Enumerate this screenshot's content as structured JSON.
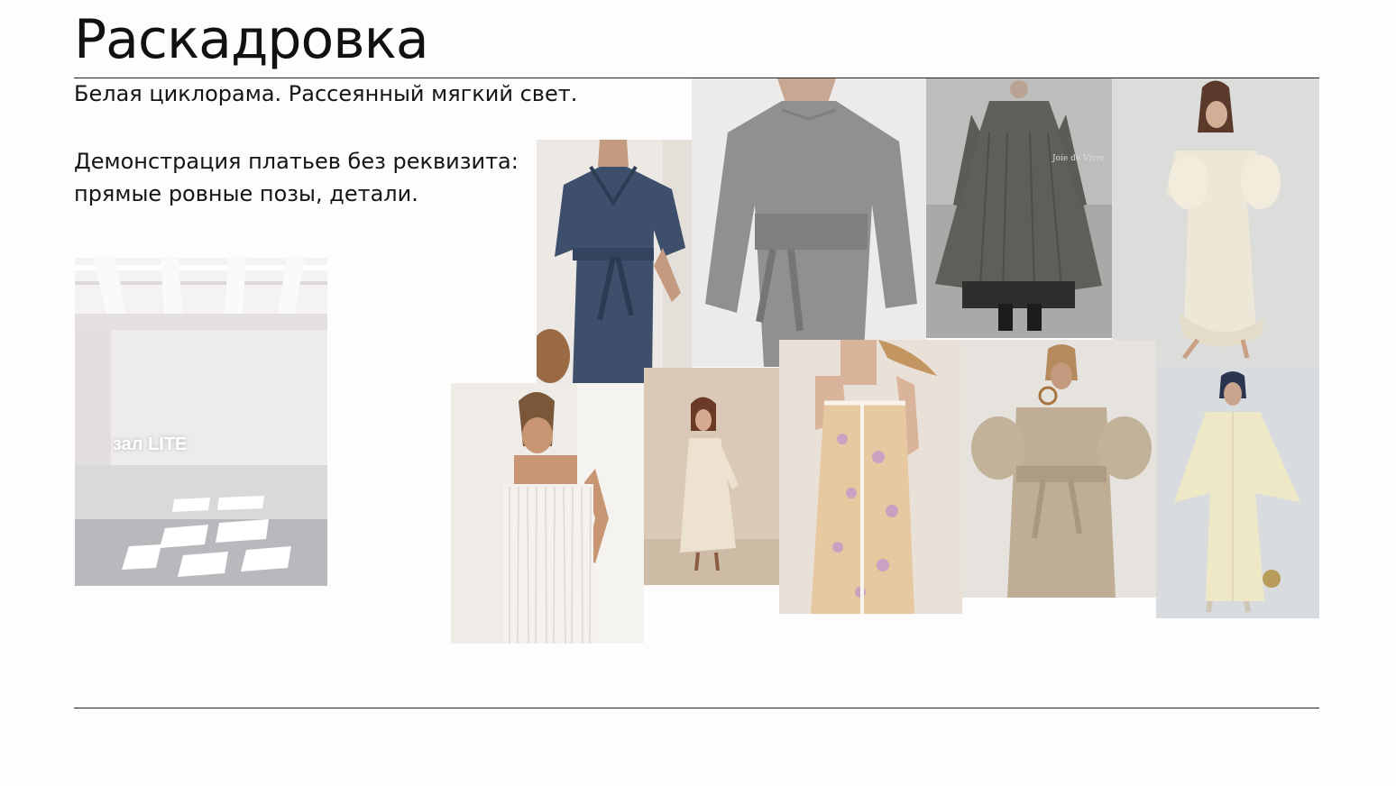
{
  "slide": {
    "title": "Раскадровка",
    "description_line1": "Белая циклорама. Рассеянный мягкий свет.",
    "description_line2": "Демонстрация платьев без реквизита:",
    "description_line3": "прямые ровные позы, детали."
  },
  "studio_photo": {
    "label": "зал LITE"
  },
  "moodboard": {
    "photos": [
      {
        "name": "navy-linen-shirt-dress",
        "palette": {
          "bg": "#ece8e3",
          "dress": "#3d4f6b"
        }
      },
      {
        "name": "grey-linen-wrap-dress",
        "palette": {
          "bg": "#ecebe9",
          "dress": "#8f9190"
        }
      },
      {
        "name": "charcoal-pleated-dress",
        "palette": {
          "bg": "#a9aaa8",
          "dress": "#5d5f5a"
        },
        "tag": "Joie de Vivre"
      },
      {
        "name": "cream-off-shoulder-dress",
        "palette": {
          "bg": "#dcdcdb",
          "dress": "#ece7d6"
        }
      },
      {
        "name": "white-fringe-dress",
        "palette": {
          "bg": "#efece7",
          "dress": "#f4f1ec"
        }
      },
      {
        "name": "cream-knit-long-dress",
        "palette": {
          "bg": "#d9c9b6",
          "dress": "#ede2cf"
        }
      },
      {
        "name": "floral-print-slip-dress",
        "palette": {
          "bg": "#e9e1d8",
          "dress": "#e6c9a0"
        }
      },
      {
        "name": "beige-puff-sleeve-dress",
        "palette": {
          "bg": "#e6e3de",
          "dress": "#bfae95"
        }
      },
      {
        "name": "butter-kaftan-dress",
        "palette": {
          "bg": "#d9dcdf",
          "dress": "#efe8c6"
        }
      }
    ]
  }
}
